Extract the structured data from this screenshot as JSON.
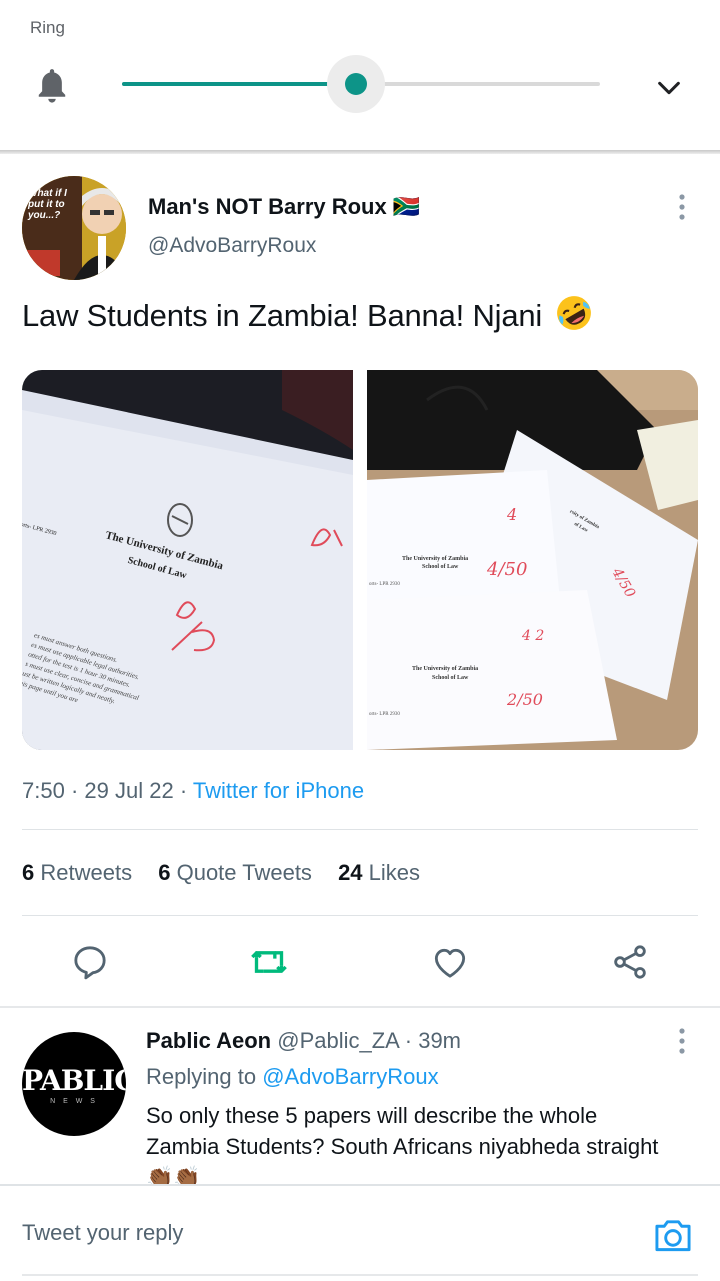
{
  "volume_panel": {
    "label": "Ring",
    "level": 0.49,
    "accent": "#0d9488",
    "icons": {
      "bell": "bell-icon",
      "expand": "chevron-down-icon"
    }
  },
  "tweet": {
    "author": {
      "display_name": "Man's NOT Barry Roux 🇿🇦",
      "handle": "@AdvoBarryRoux",
      "avatar_caption": "What if I put it to you...?"
    },
    "text": "Law Students in Zambia! Banna! Njani",
    "emoji": "rolling-on-floor-laughing-icon",
    "media": {
      "left": {
        "heading_1": "The University of Zambia",
        "heading_2": "School of Law",
        "course": "orts- LPR 2930",
        "score": "0/50",
        "score_top": "0/",
        "lines": [
          "es must answer both questions.",
          "es must use applicable legal authorities.",
          "otted for the test is 1 hour 30 minutes.",
          "s must use clear, concise and grammatical",
          "ust be written logically and neatly.",
          "his page until you are"
        ]
      },
      "right": {
        "heading_1": "The University of Zambia",
        "heading_2": "School of Law",
        "score_a": "4/50",
        "score_b": "2/50",
        "score_c": "4/50",
        "mark_a": "4",
        "mark_b": "4 2",
        "course": "orts- LPR 2930",
        "corner_heading": "rsity of Zambia",
        "corner_sub": "of Law"
      }
    },
    "time": "7:50",
    "date": "29 Jul 22",
    "source": "Twitter for iPhone",
    "stats": {
      "retweets_count": "6",
      "retweets_label": "Retweets",
      "quotes_count": "6",
      "quotes_label": "Quote Tweets",
      "likes_count": "24",
      "likes_label": "Likes"
    },
    "actions": [
      "reply-icon",
      "retweet-icon",
      "like-icon",
      "share-icon"
    ],
    "retweet_color": "#00ba7c"
  },
  "reply": {
    "avatar_text": "PABLIC",
    "avatar_sub": "N E W S",
    "name": "Pablic Aeon",
    "handle": "@Pablic_ZA",
    "time": "39m",
    "replying_prefix": "Replying to",
    "replying_to": "@AdvoBarryRoux",
    "text": "So only these 5 papers will describe the whole Zambia Students? South Africans niyabheda straight 👏🏾👏🏾"
  },
  "compose": {
    "placeholder": "Tweet your reply",
    "camera": "camera-icon"
  }
}
